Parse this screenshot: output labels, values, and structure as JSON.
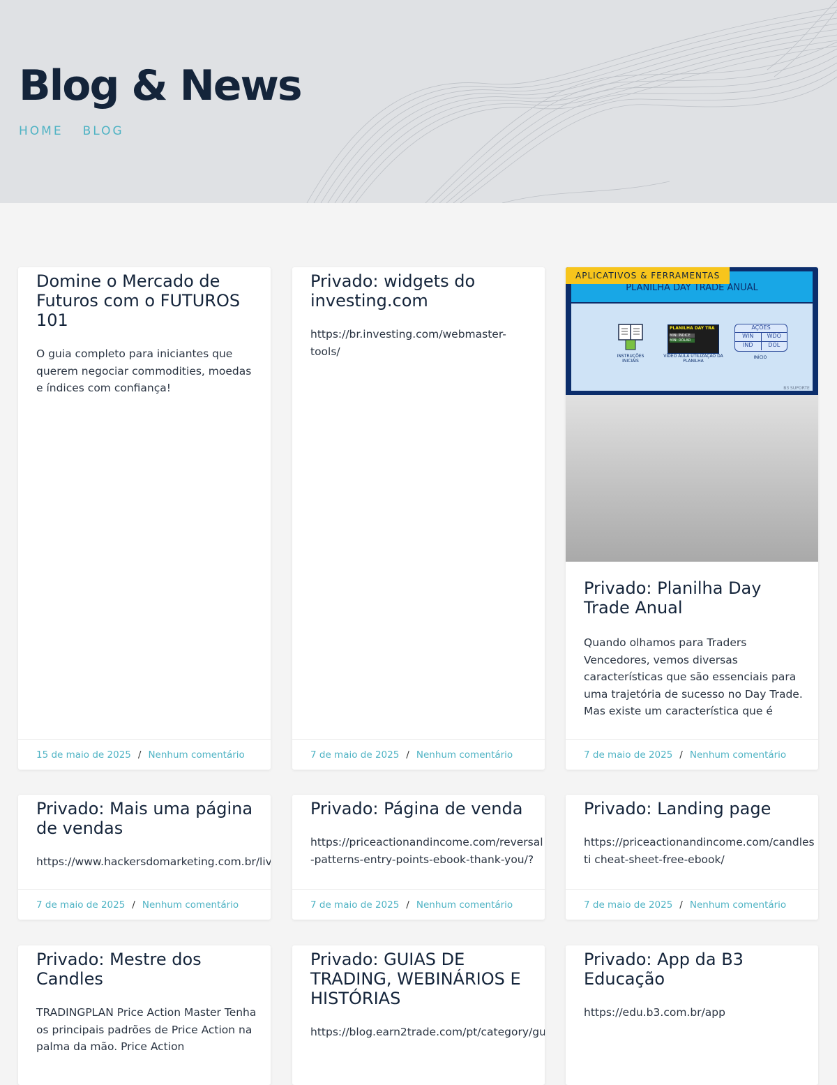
{
  "hero": {
    "title": "Blog & News",
    "breadcrumb": [
      "HOME",
      "BLOG"
    ]
  },
  "colors": {
    "accent": "#4fb3c4",
    "heading": "#14243a",
    "badge": "#f7c51c"
  },
  "posts": [
    {
      "title": "Domine o Mercado de Futuros com o FUTUROS 101",
      "excerpt": "O guia completo para iniciantes que querem negociar commodities, moedas e índices com confiança!",
      "date": "15 de maio de 2025",
      "comments": "Nenhum comentário"
    },
    {
      "title": "Privado: widgets do investing.com",
      "excerpt": "https://br.investing.com/webmaster-tools/",
      "date": "7 de maio de 2025",
      "comments": "Nenhum comentário"
    },
    {
      "title": "Privado: Planilha Day Trade Anual",
      "category": "APLICATIVOS & FERRAMENTAS",
      "thumb_title": "PLANILHA DAY TRADE ANUAL",
      "thumb_labels": {
        "instrucoes": "INSTRUÇÕES INICIAIS",
        "video": "VÍDEO AULA UTILIZAÇÃO DA PLANILHA",
        "inicio": "INÍCIO",
        "acoes": "AÇÕES",
        "win": "WIN",
        "wdo": "WDO",
        "ind": "IND",
        "dol": "DOL",
        "planilha": "PLANILHA DAY TRA",
        "mini_indice": "MINI ÍNDICE",
        "mini_dolar": "MINI DÓLAR",
        "suporte": "B3 SUPORTE"
      },
      "excerpt": "Quando olhamos para Traders Vencedores, vemos diversas características que são essenciais para uma trajetória de sucesso no Day Trade. Mas existe um característica que é",
      "date": "7 de maio de 2025",
      "comments": "Nenhum comentário"
    },
    {
      "title": "Privado: Mais uma página de vendas",
      "excerpt": "https://www.hackersdomarketing.com.br/liv",
      "date": "7 de maio de 2025",
      "comments": "Nenhum comentário"
    },
    {
      "title": "Privado: Página de venda",
      "excerpt": "https://priceactionandincome.com/reversal-patterns-entry-points-ebook-thank-you/?",
      "date": "7 de maio de 2025",
      "comments": "Nenhum comentário"
    },
    {
      "title": "Privado: Landing page",
      "excerpt": "https://priceactionandincome.com/candlesti cheat-sheet-free-ebook/",
      "date": "7 de maio de 2025",
      "comments": "Nenhum comentário"
    },
    {
      "title": "Privado: Mestre dos Candles",
      "excerpt": "TRADINGPLAN Price Action Master Tenha os principais padrões de Price Action na palma da mão. Price Action"
    },
    {
      "title": "Privado: GUIAS DE TRADING, WEBINÁRIOS E HISTÓRIAS",
      "excerpt": "https://blog.earn2trade.com/pt/category/gu"
    },
    {
      "title": "Privado: App da B3 Educação",
      "excerpt": "https://edu.b3.com.br/app"
    }
  ],
  "meta_separator": "/"
}
